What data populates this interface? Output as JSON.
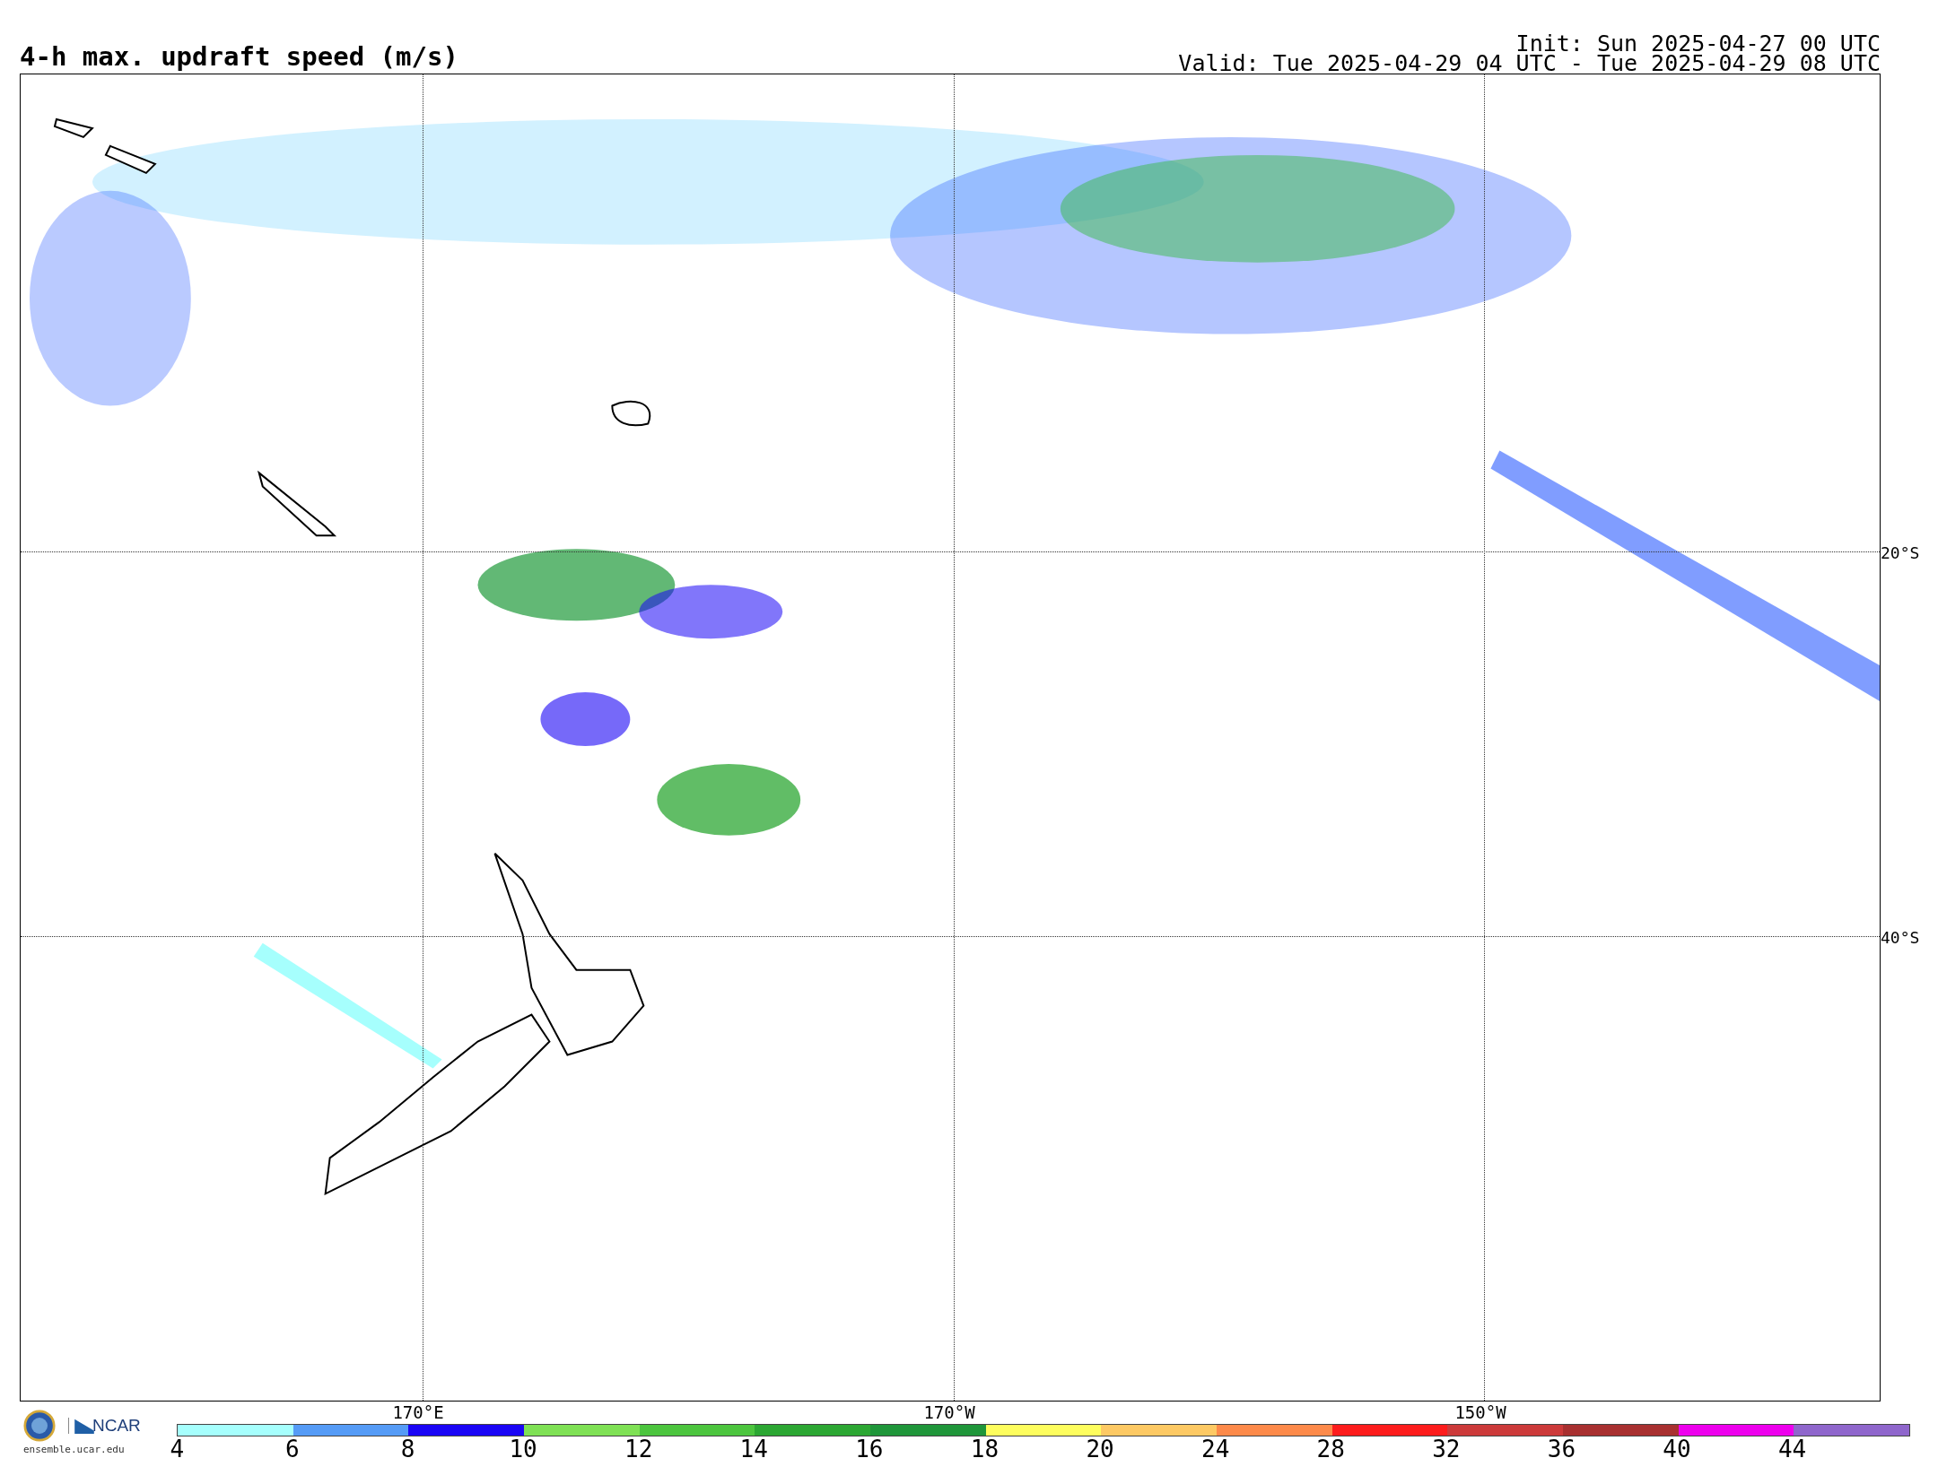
{
  "title": "4-h max. updraft speed (m/s)",
  "init": "Init: Sun 2025-04-27 00 UTC",
  "valid": "Valid: Tue 2025-04-29 04 UTC - Tue 2025-04-29 08 UTC",
  "lat_labels": [
    "20°S",
    "40°S"
  ],
  "lon_labels": [
    "170°E",
    "170°W",
    "150°W"
  ],
  "logo": {
    "text": "NCAR",
    "url": "ensemble.ucar.edu"
  },
  "colorbar": [
    {
      "label": "4",
      "color": "#a6fffd"
    },
    {
      "label": "6",
      "color": "#559bf6"
    },
    {
      "label": "8",
      "color": "#1a05f5"
    },
    {
      "label": "10",
      "color": "#7fe155"
    },
    {
      "label": "12",
      "color": "#4cc53e"
    },
    {
      "label": "14",
      "color": "#2ca733"
    },
    {
      "label": "16",
      "color": "#1f963a"
    },
    {
      "label": "18",
      "color": "#fefe5e"
    },
    {
      "label": "20",
      "color": "#fdc964"
    },
    {
      "label": "24",
      "color": "#fd8a4a"
    },
    {
      "label": "28",
      "color": "#fd1c1c"
    },
    {
      "label": "32",
      "color": "#cc3a3a"
    },
    {
      "label": "36",
      "color": "#a83030"
    },
    {
      "label": "40",
      "color": "#ee00ee"
    },
    {
      "label": "44",
      "color": "#8f66cc"
    }
  ]
}
